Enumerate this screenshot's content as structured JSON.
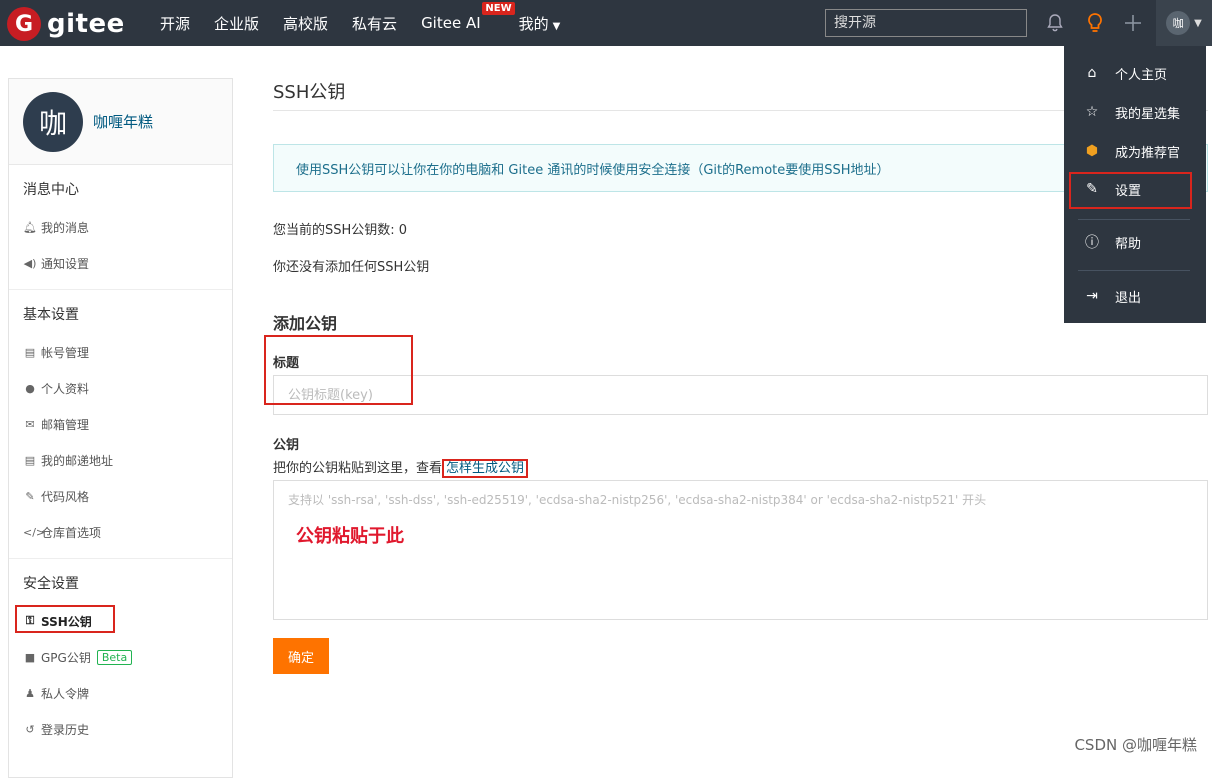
{
  "topbar": {
    "logo_mark": "G",
    "logo_text": "gitee",
    "nav": [
      "开源",
      "企业版",
      "高校版",
      "私有云",
      "Gitee AI"
    ],
    "new_badge": "NEW",
    "mine": "我的",
    "search_placeholder": "搜开源",
    "user_avatar": "咖"
  },
  "sidebar": {
    "avatar_text": "咖",
    "username": "咖喱年糕",
    "sections": {
      "messages": {
        "title": "消息中心",
        "items": [
          "我的消息",
          "通知设置"
        ]
      },
      "basic": {
        "title": "基本设置",
        "items": [
          "帐号管理",
          "个人资料",
          "邮箱管理",
          "我的邮递地址",
          "代码风格",
          "仓库首选项"
        ]
      },
      "security": {
        "title": "安全设置",
        "items": [
          "SSH公钥",
          "GPG公钥",
          "私人令牌",
          "登录历史"
        ],
        "beta": "Beta"
      }
    }
  },
  "main": {
    "title": "SSH公钥",
    "info": "使用SSH公钥可以让你在你的电脑和 Gitee 通讯的时候使用安全连接（Git的Remote要使用SSH地址）",
    "count_text": "您当前的SSH公钥数: 0",
    "none_text": "你还没有添加任何SSH公钥",
    "add_title": "添加公钥",
    "title_label": "标题",
    "title_placeholder": "公钥标题(key)",
    "key_label": "公钥",
    "key_hint": "把你的公钥粘贴到这里，查看",
    "key_hint_link": "怎样生成公钥",
    "key_placeholder": "支持以 'ssh-rsa', 'ssh-dss', 'ssh-ed25519', 'ecdsa-sha2-nistp256', 'ecdsa-sha2-nistp384' or 'ecdsa-sha2-nistp521' 开头",
    "annotation": "公钥粘贴于此",
    "confirm": "确定"
  },
  "dropdown": {
    "items": [
      "个人主页",
      "我的星选集",
      "成为推荐官",
      "设置",
      "帮助",
      "退出"
    ]
  },
  "watermark": "CSDN @咖喱年糕",
  "colors": {
    "accent": "#fe7300",
    "topbar": "#2e3640",
    "highlight": "#d9251d"
  }
}
